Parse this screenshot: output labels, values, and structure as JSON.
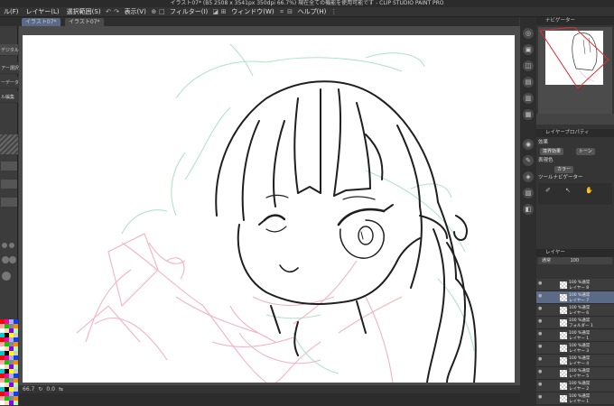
{
  "app": {
    "title": "イラスト07* (B5 2508 x 3541px 350dpi 66.7%)  現在全ての機能を使用可能です - CLIP STUDIO PAINT PRO"
  },
  "menu": {
    "items": [
      "ル(F)",
      "レイヤー(L)",
      "選択範囲(S)",
      "表示(V)",
      "フィルター(I)",
      "ウィンドウ(W)",
      "ヘルプ(H)"
    ]
  },
  "tabs": [
    "イラスト07*",
    "イラスト07*"
  ],
  "tool_panel": {
    "labels": [
      "デジタル",
      "アー選択",
      "ーデータ",
      "ル編集"
    ]
  },
  "status": {
    "zoom": "66.7",
    "angle": "0.0"
  },
  "navigator": {
    "title": "ナビゲーター"
  },
  "layer_property": {
    "title": "レイヤープロパティ",
    "effect_label": "効果",
    "border_effect": "境界効果",
    "tone_label": "トーン",
    "expression_label": "表現色",
    "color_label": "カラー",
    "ruler_label": "ツールナビゲーター"
  },
  "layers": {
    "title": "レイヤー",
    "blend_mode": "通常",
    "opacity": "100",
    "rows": [
      {
        "line1": "100 %通常",
        "line2": "レイヤー 8",
        "selected": false
      },
      {
        "line1": "100 %通常",
        "line2": "レイヤー 7",
        "selected": true
      },
      {
        "line1": "100 %通常",
        "line2": "レイヤー 6",
        "selected": false
      },
      {
        "line1": "100 %通常",
        "line2": "フォルダー 1",
        "selected": false
      },
      {
        "line1": "100 %通常",
        "line2": "レイヤー 1",
        "selected": false
      },
      {
        "line1": "100 %通常",
        "line2": "レイヤー 3",
        "selected": false
      },
      {
        "line1": "100 %通常",
        "line2": "レイヤー 4",
        "selected": false
      },
      {
        "line1": "100 %通常",
        "line2": "レイヤー 5",
        "selected": false
      },
      {
        "line1": "100 %通常",
        "line2": "レイヤー 2",
        "selected": false
      },
      {
        "line1": "100 %通常",
        "line2": "レイヤー 1",
        "selected": false
      }
    ]
  },
  "colors": {
    "accent_selected": "#5b6a86",
    "sketch_pink": "#f0a6b8",
    "sketch_mint": "#a8e0c4",
    "line_art": "#1f1f1f"
  }
}
